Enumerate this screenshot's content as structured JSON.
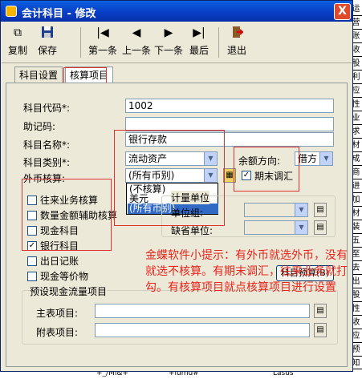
{
  "background": {
    "sheet_cells": [
      "运",
      "营",
      "账",
      "收",
      "股",
      "利",
      "应",
      "性",
      "业",
      "求",
      "材",
      "成",
      "商",
      "进",
      "加",
      "材",
      "装",
      "五",
      "至",
      "去",
      "出",
      "股",
      "性",
      "收",
      "应",
      "预",
      "知"
    ],
    "bottom_text": [
      "+_/Mi&+",
      "+iumu#",
      "Lasus"
    ]
  },
  "window": {
    "title": "会计科目 - 修改",
    "close_label": "X"
  },
  "toolbar": {
    "copy": "复制",
    "save": "保存",
    "first": "第一条",
    "prev": "上一条",
    "next": "下一条",
    "last": "最后",
    "exit": "退出"
  },
  "tabs": [
    "科目设置",
    "核算项目"
  ],
  "form": {
    "code_label": "科目代码*:",
    "code_value": "1002",
    "mnemonic_label": "助记码:",
    "mnemonic_value": "",
    "name_label": "科目名称*:",
    "name_value": "银行存款",
    "category_label": "科目类别*:",
    "category_value": "流动资产",
    "balance_label": "余额方向:",
    "balance_value": "借方",
    "currency_label": "外币核算:",
    "currency_value": "(所有币别)",
    "period_end_label": "期末调汇",
    "currency_options": [
      "(不核算)",
      "美元",
      "(所有币别)"
    ],
    "checkboxes": [
      {
        "label": "往来业务核算",
        "checked": false
      },
      {
        "label": "数量金额辅助核算",
        "checked": false
      },
      {
        "label": "现金科目",
        "checked": false
      },
      {
        "label": "银行科目",
        "checked": true
      },
      {
        "label": "出日记账",
        "checked": false
      },
      {
        "label": "现金等价物",
        "checked": false
      }
    ],
    "unit_group_label": "计量单位",
    "unit_label": "单位组:",
    "default_unit_label": "缺省单位:",
    "budget_button": "科目预算(B)",
    "cashflow_group": "预设现金流量项目",
    "main_item_label": "主表项目:",
    "sub_item_label": "附表项目:"
  },
  "annotation": "金蝶软件小提示：有外币就选外币，没有就选不核算。有期末调汇，往来业务就打勾。有核算项目就点核算项目进行设置"
}
